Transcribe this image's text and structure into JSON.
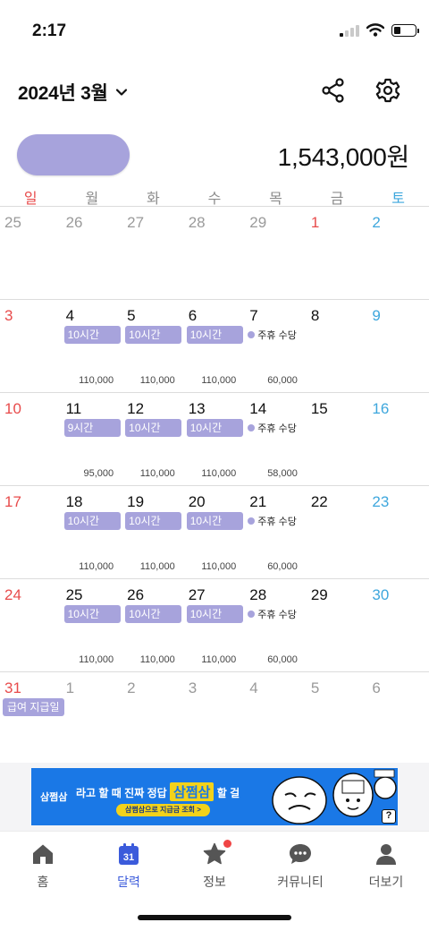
{
  "status_bar": {
    "time": "2:17",
    "battery_level": 0.3
  },
  "header": {
    "month_title": "2024년 3월",
    "icons": {
      "dropdown": "chevron-down-icon",
      "share": "share-icon",
      "settings": "gear-icon"
    }
  },
  "summary": {
    "total": "1,543,000원",
    "accent_color": "#a7a3dc"
  },
  "weekdays": [
    "일",
    "월",
    "화",
    "수",
    "목",
    "금",
    "토"
  ],
  "weeks": [
    {
      "days": [
        {
          "date": "25",
          "kind": "other"
        },
        {
          "date": "26",
          "kind": "other"
        },
        {
          "date": "27",
          "kind": "other"
        },
        {
          "date": "28",
          "kind": "other"
        },
        {
          "date": "29",
          "kind": "other"
        },
        {
          "date": "1",
          "kind": "sun-red"
        },
        {
          "date": "2",
          "kind": "sat"
        }
      ]
    },
    {
      "days": [
        {
          "date": "3",
          "kind": "sun"
        },
        {
          "date": "4",
          "shift": "10시간",
          "pay": "110,000"
        },
        {
          "date": "5",
          "shift": "10시간",
          "pay": "110,000"
        },
        {
          "date": "6",
          "shift": "10시간",
          "pay": "110,000"
        },
        {
          "date": "7",
          "allowance": "주휴 수당",
          "pay": "60,000"
        },
        {
          "date": "8"
        },
        {
          "date": "9",
          "kind": "sat"
        }
      ]
    },
    {
      "days": [
        {
          "date": "10",
          "kind": "sun"
        },
        {
          "date": "11",
          "shift": "9시간",
          "pay": "95,000"
        },
        {
          "date": "12",
          "shift": "10시간",
          "pay": "110,000"
        },
        {
          "date": "13",
          "shift": "10시간",
          "pay": "110,000"
        },
        {
          "date": "14",
          "allowance": "주휴 수당",
          "pay": "58,000"
        },
        {
          "date": "15"
        },
        {
          "date": "16",
          "kind": "sat"
        }
      ]
    },
    {
      "days": [
        {
          "date": "17",
          "kind": "sun"
        },
        {
          "date": "18",
          "shift": "10시간",
          "pay": "110,000"
        },
        {
          "date": "19",
          "shift": "10시간",
          "pay": "110,000"
        },
        {
          "date": "20",
          "shift": "10시간",
          "pay": "110,000"
        },
        {
          "date": "21",
          "allowance": "주휴 수당",
          "pay": "60,000"
        },
        {
          "date": "22"
        },
        {
          "date": "23",
          "kind": "sat"
        }
      ]
    },
    {
      "days": [
        {
          "date": "24",
          "kind": "sun"
        },
        {
          "date": "25",
          "shift": "10시간",
          "pay": "110,000"
        },
        {
          "date": "26",
          "shift": "10시간",
          "pay": "110,000"
        },
        {
          "date": "27",
          "shift": "10시간",
          "pay": "110,000"
        },
        {
          "date": "28",
          "allowance": "주휴 수당",
          "pay": "60,000"
        },
        {
          "date": "29"
        },
        {
          "date": "30",
          "kind": "sat"
        }
      ]
    },
    {
      "days": [
        {
          "date": "31",
          "kind": "sun",
          "payday": "급여 지급일"
        },
        {
          "date": "1",
          "kind": "other"
        },
        {
          "date": "2",
          "kind": "other"
        },
        {
          "date": "3",
          "kind": "other"
        },
        {
          "date": "4",
          "kind": "other"
        },
        {
          "date": "5",
          "kind": "other"
        },
        {
          "date": "6",
          "kind": "other"
        }
      ]
    }
  ],
  "ad": {
    "logo": "삼쩜삼",
    "headline_pre": "라고 할 때 진짜 정답",
    "headline_highlight": "삼쩜삼",
    "headline_post": "할 걸",
    "cta": "삼쩜삼으로 지급금 조회 >",
    "info_label": "?"
  },
  "bottom_nav": [
    {
      "label": "홈",
      "icon": "home-icon",
      "active": false
    },
    {
      "label": "달력",
      "icon": "calendar-icon",
      "active": true,
      "badge": "31"
    },
    {
      "label": "정보",
      "icon": "star-icon",
      "active": false,
      "dot": true
    },
    {
      "label": "커뮤니티",
      "icon": "chat-bubble-icon",
      "active": false
    },
    {
      "label": "더보기",
      "icon": "person-icon",
      "active": false
    }
  ]
}
